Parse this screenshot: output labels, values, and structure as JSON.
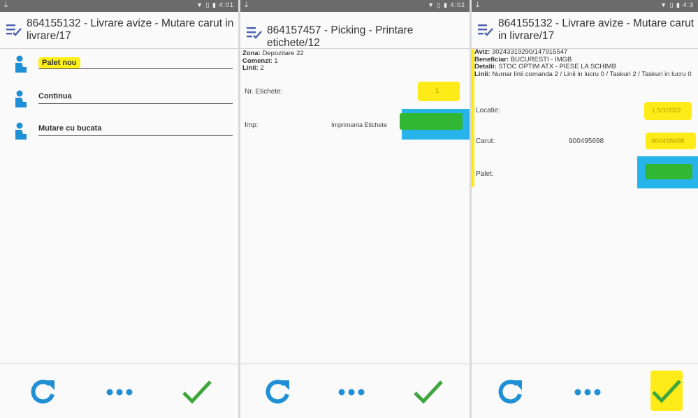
{
  "colors": {
    "accent_blue": "#1f8fd6",
    "check_green": "#3fa63f",
    "highlight_yellow": "#ffeb17",
    "highlight_cyan": "#27b4ea",
    "highlight_green": "#32b734"
  },
  "screens": [
    {
      "title": "864155132 - Livrare avize - Mutare carut in livrare/17",
      "actions": [
        "Palet nou",
        "Continua",
        "Mutare cu bucata"
      ],
      "clock": "4:01"
    },
    {
      "title": "864157457 - Picking - Printare etichete/12",
      "info": {
        "zona_label": "Zona:",
        "zona": "Depozitare 22",
        "comenzi_label": "Comenzi:",
        "comenzi": "1",
        "linii_label": "Linii:",
        "linii": "2"
      },
      "fields": {
        "nr_label": "Nr. Etichete:",
        "nr_value": "1",
        "imp_label": "Imp:",
        "imp_value": "Imprimanta Etichete"
      },
      "clock": "4:02"
    },
    {
      "title": "864155132 - Livrare avize - Mutare carut in livrare/17",
      "info": {
        "aviz_label": "Aviz:",
        "aviz": "30243319290/147915547",
        "beneficiar_label": "Beneficiar:",
        "beneficiar": "BUCURESTI - IMGB",
        "detalii_label": "Detalii:",
        "detalii": "STOC OPTIM ATX - PIESE LA SCHIMB",
        "linii_label": "Linii:",
        "linii": "Numar linii comanda 2 / Linii in lucru 0 / Taskuri 2 / Taskuri in lucru 0"
      },
      "fields": {
        "locatie_label": "Locatie:",
        "locatie_value": "LIV10022",
        "carut_label": "Carut:",
        "carut_code": "900495698",
        "carut_value": "900495698",
        "palet_label": "Palet:"
      },
      "clock": "4:3"
    }
  ],
  "icons": {
    "refresh": "refresh-icon",
    "more": "more-dots-icon",
    "confirm": "checkmark-icon",
    "menu": "menu-check-icon",
    "user": "person-icon"
  }
}
